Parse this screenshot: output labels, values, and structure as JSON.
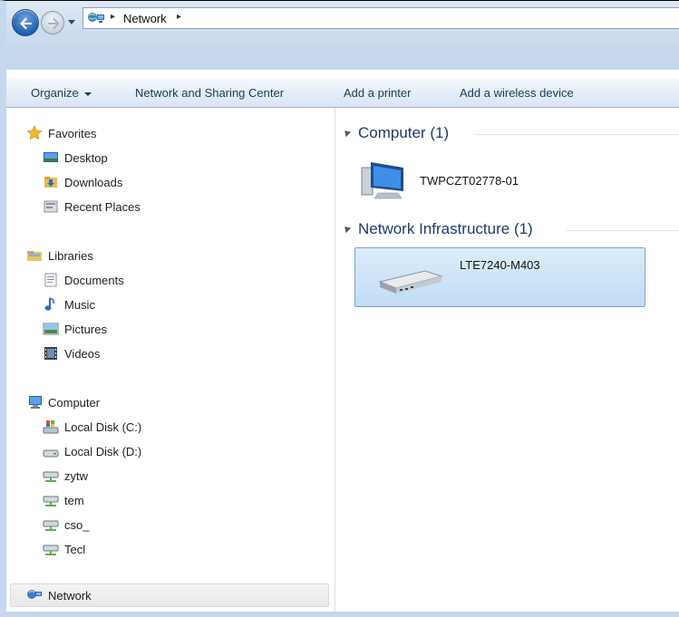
{
  "address": {
    "crumb": "Network",
    "sep1": "▸",
    "sep2": "▸"
  },
  "toolbar": {
    "organize": "Organize",
    "network_sharing": "Network and Sharing Center",
    "add_printer": "Add a printer",
    "add_wireless": "Add a wireless device"
  },
  "sidebar": {
    "favorites": "Favorites",
    "desktop": "Desktop",
    "downloads": "Downloads",
    "recent_places": "Recent Places",
    "libraries": "Libraries",
    "documents": "Documents",
    "music": "Music",
    "pictures": "Pictures",
    "videos": "Videos",
    "computer": "Computer",
    "local_disk_c": "Local Disk (C:)",
    "local_disk_d": "Local Disk (D:)",
    "share1": "zytw",
    "share2": "tem",
    "share3": "cso_",
    "share4": "Tecl",
    "network": "Network"
  },
  "content": {
    "computer_group": "Computer (1)",
    "computer_item": "TWPCZT02778-01",
    "infra_group": "Network Infrastructure (1)",
    "infra_item": "LTE7240-M403"
  },
  "colors": {
    "accent": "#1e395b",
    "group_header": "#1e3a6c",
    "selection": "#c2dcf3"
  }
}
